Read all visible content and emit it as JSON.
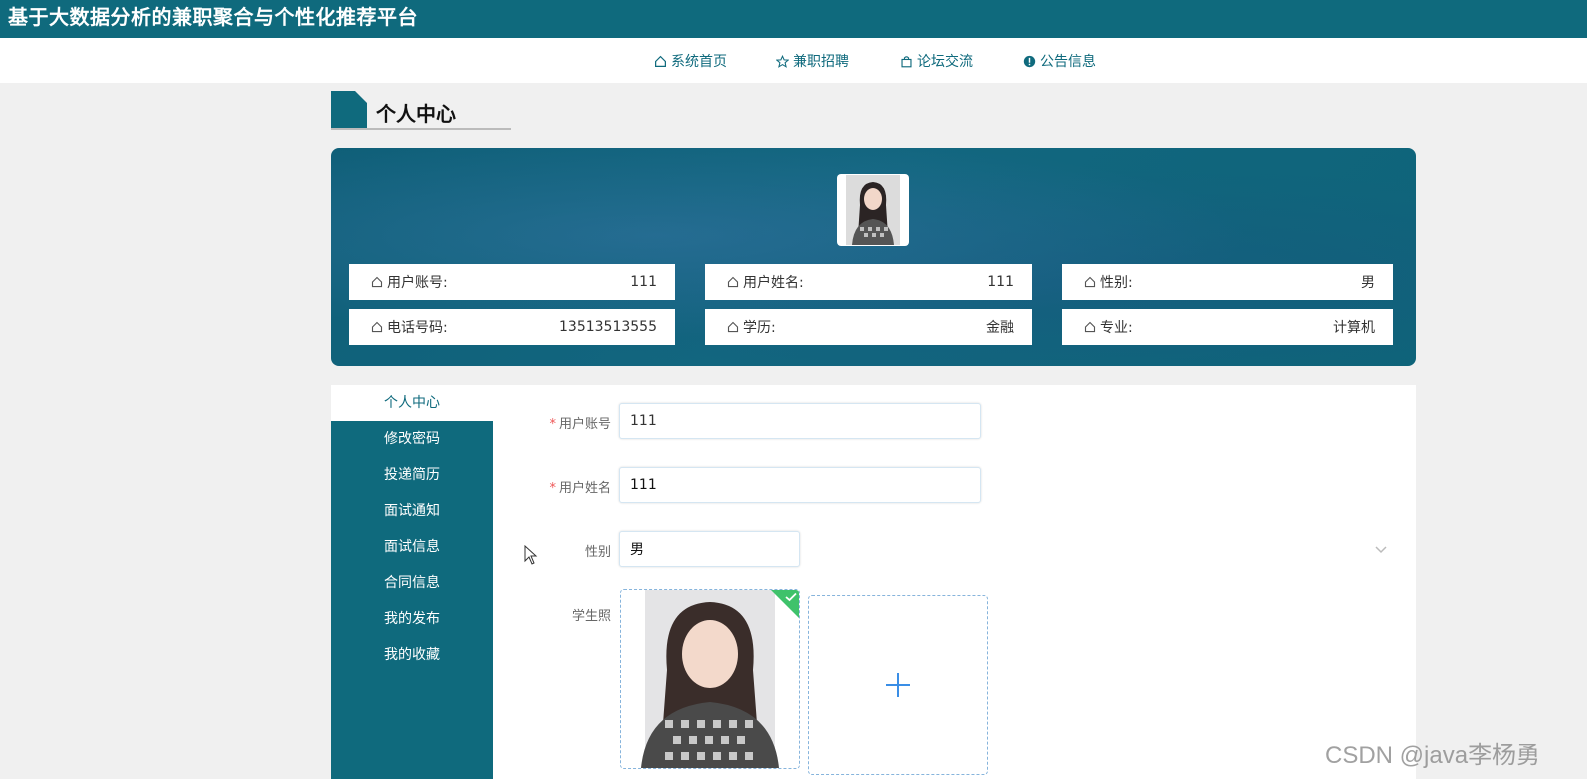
{
  "header": {
    "site_title": "基于大数据分析的兼职聚合与个性化推荐平台"
  },
  "nav": {
    "items": [
      {
        "label": "系统首页",
        "icon": "home-icon"
      },
      {
        "label": "兼职招聘",
        "icon": "star-icon"
      },
      {
        "label": "论坛交流",
        "icon": "bag-icon"
      },
      {
        "label": "公告信息",
        "icon": "info-icon"
      }
    ]
  },
  "section": {
    "title": "个人中心"
  },
  "profile": {
    "fields": [
      {
        "label": "用户账号:",
        "value": "111"
      },
      {
        "label": "用户姓名:",
        "value": "111"
      },
      {
        "label": "性别:",
        "value": "男"
      },
      {
        "label": "电话号码:",
        "value": "13513513555"
      },
      {
        "label": "学历:",
        "value": "金融"
      },
      {
        "label": "专业:",
        "value": "计算机"
      }
    ]
  },
  "sidebar": {
    "items": [
      {
        "label": "个人中心",
        "active": true
      },
      {
        "label": "修改密码"
      },
      {
        "label": "投递简历"
      },
      {
        "label": "面试通知"
      },
      {
        "label": "面试信息"
      },
      {
        "label": "合同信息"
      },
      {
        "label": "我的发布"
      },
      {
        "label": "我的收藏"
      }
    ]
  },
  "form": {
    "account": {
      "label": "用户账号",
      "value": "111",
      "required": true
    },
    "name": {
      "label": "用户姓名",
      "value": "111",
      "required": true
    },
    "gender": {
      "label": "性别",
      "value": "男"
    },
    "photo": {
      "label": "学生照"
    }
  },
  "watermark": "CSDN @java李杨勇",
  "colors": {
    "primary": "#0f6a7d",
    "success": "#3fc26b",
    "upload_border": "#86b4dc"
  }
}
